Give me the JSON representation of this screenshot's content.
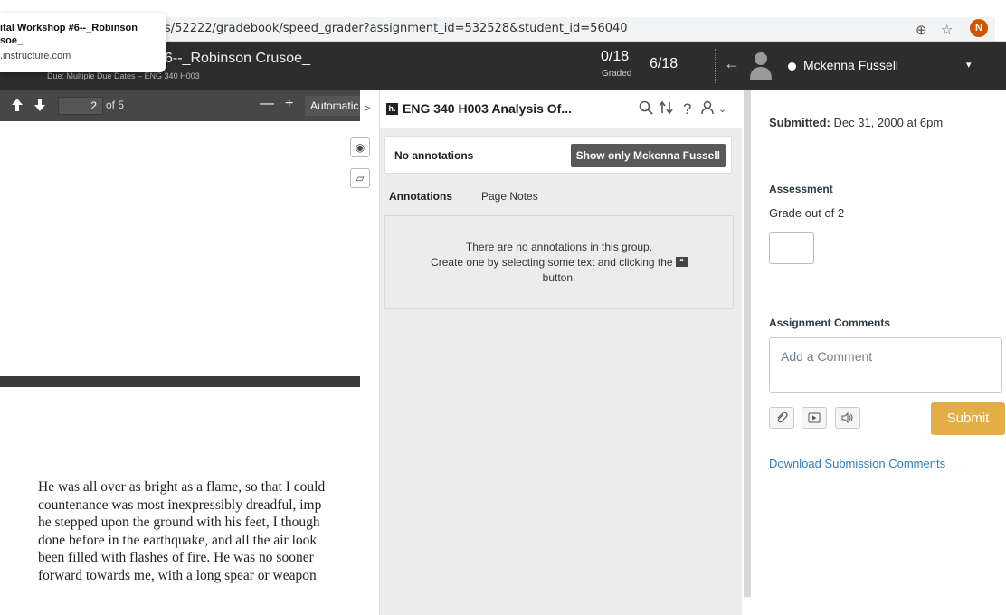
{
  "browser": {
    "url": "s/52222/gradebook/speed_grader?assignment_id=532528&student_id=56040",
    "tab_tooltip_title": "ital Workshop #6--_Robinson",
    "tab_tooltip_title2": "soe_",
    "tab_tooltip_domain": ".instructure.com",
    "zoom_icon": "⊕",
    "star_icon": "☆",
    "profile_initial": "N"
  },
  "header": {
    "assignment_title": "6--_Robinson Crusoe_",
    "assignment_sub": "Due: Multiple Due Dates – ENG 340 H003",
    "graded_count": "0/18",
    "graded_label": "Graded",
    "student_index": "6/18",
    "prev_arrow": "←",
    "student_name": "Mckenna Fussell",
    "caret": "▾"
  },
  "pdf": {
    "page_number": "2",
    "page_of": "of 5",
    "zoom_out": "—",
    "zoom_in": "+",
    "zoom_value": "Automatic",
    "text_lines": [
      "He was all over as bright as a flame, so that I could",
      "countenance was most inexpressibly dreadful, imp",
      "he stepped upon the ground with his feet, I though",
      "done before in the earthquake, and all the air look",
      "been filled with flashes of fire.  He was no sooner",
      "forward towards me, with a long spear or weapon"
    ]
  },
  "annotations": {
    "collapse": ">",
    "group_name": "ENG 340 H003 Analysis Of...",
    "no_annotations": "No annotations",
    "show_only_button": "Show only Mckenna Fussell",
    "tab_annotations": "Annotations",
    "tab_page_notes": "Page Notes",
    "empty_line1": "There are no annotations in this group.",
    "empty_line2": "Create one by selecting some text and clicking the",
    "empty_line3": "button."
  },
  "grading": {
    "submitted_label": "Submitted:",
    "submitted_date": "Dec 31, 2000 at 6pm",
    "assessment_heading": "Assessment",
    "grade_label": "Grade out of 2",
    "grade_value": "",
    "comments_heading": "Assignment Comments",
    "comment_placeholder": "Add a Comment",
    "submit_label": "Submit",
    "download_link": "Download Submission Comments"
  }
}
